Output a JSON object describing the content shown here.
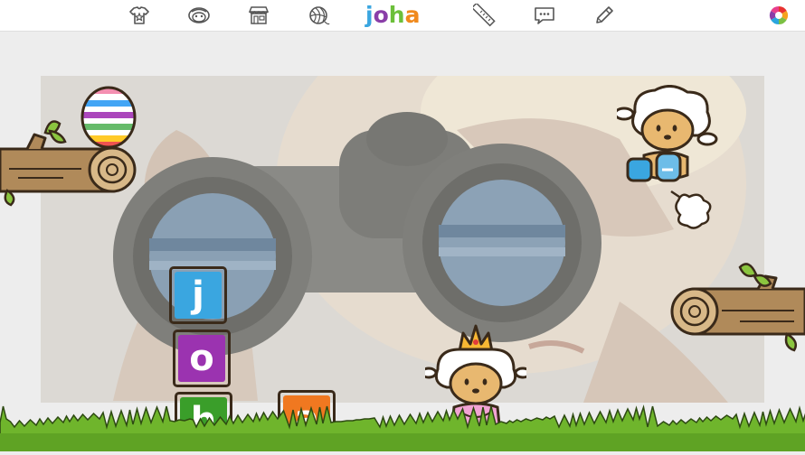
{
  "logo": {
    "letters": [
      "j",
      "o",
      "h",
      "a"
    ],
    "colors": [
      "#3aa6e0",
      "#8a3ea8",
      "#6cbf3a",
      "#f08a1d"
    ]
  },
  "nav": [
    {
      "name": "shirt-star-icon"
    },
    {
      "name": "sheep-face-icon"
    },
    {
      "name": "shop-icon"
    },
    {
      "name": "yarn-ball-icon"
    },
    {
      "name": "ruler-icon"
    },
    {
      "name": "speech-bubble-icon"
    },
    {
      "name": "pencil-icon"
    },
    {
      "name": "color-wheel-icon"
    }
  ],
  "blocks": [
    {
      "letter": "j",
      "color": "#3aa6e0"
    },
    {
      "letter": "o",
      "color": "#9b33b0"
    },
    {
      "letter": "h",
      "color": "#3a9e2a"
    },
    {
      "letter": "a",
      "color": "#f07820"
    }
  ]
}
